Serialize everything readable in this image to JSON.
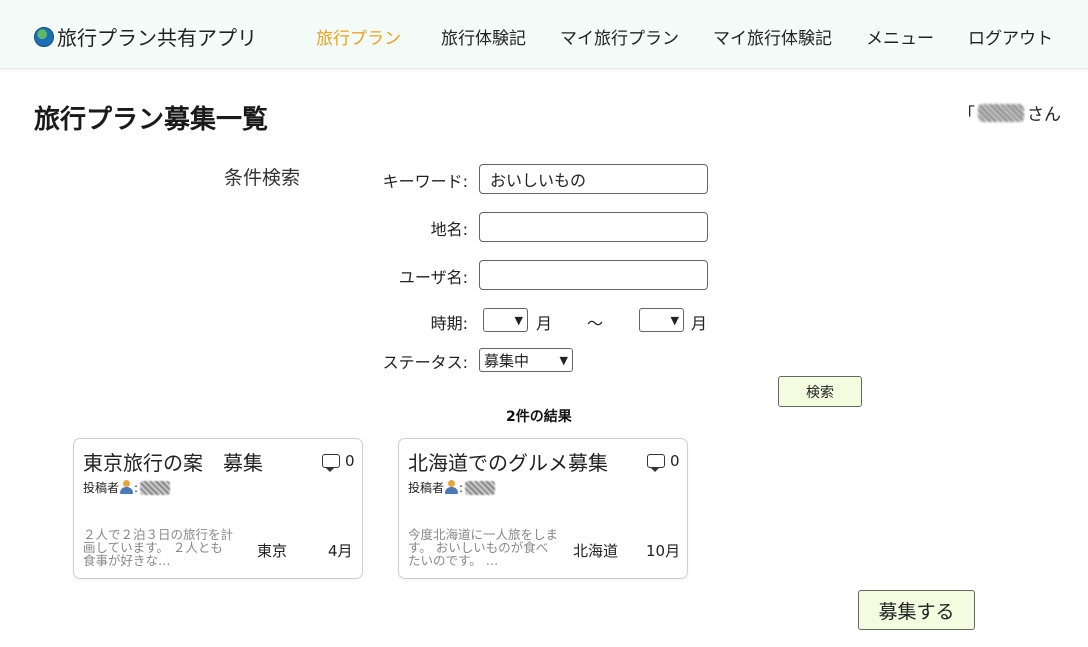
{
  "header": {
    "brand": "旅行プラン共有アプリ",
    "nav": [
      "旅行プラン",
      "旅行体験記",
      "マイ旅行プラン",
      "マイ旅行体験記",
      "メニュー",
      "ログアウト"
    ],
    "active_color": "#f0a020"
  },
  "page": {
    "title": "旅行プラン募集一覧",
    "greeting_prefix": "「",
    "greeting_suffix": "さん"
  },
  "search": {
    "heading": "条件検索",
    "keyword_label": "キーワード:",
    "keyword_value": "おいしいもの",
    "place_label": "地名:",
    "place_value": "",
    "user_label": "ユーザ名:",
    "user_value": "",
    "period_label": "時期:",
    "period_from": "",
    "month_unit": "月",
    "tilde": "～",
    "period_to": "",
    "status_label": "ステータス:",
    "status_value": "募集中",
    "search_button": "検索"
  },
  "results": {
    "count_text": "2件の結果",
    "cards": [
      {
        "title": "東京旅行の案　募集",
        "comments": "0",
        "poster_label": "投稿者",
        "poster_sep": ":",
        "description": "２人で２泊３日の旅行を計画しています。 ２人とも食事が好きな…",
        "place": "東京",
        "month": "4月"
      },
      {
        "title": "北海道でのグルメ募集",
        "comments": "0",
        "poster_label": "投稿者",
        "poster_sep": ":",
        "description": "今度北海道に一人旅をします。 おいしいものが食べたいのです。 …",
        "place": "北海道",
        "month": "10月"
      }
    ]
  },
  "actions": {
    "recruit_button": "募集する"
  }
}
